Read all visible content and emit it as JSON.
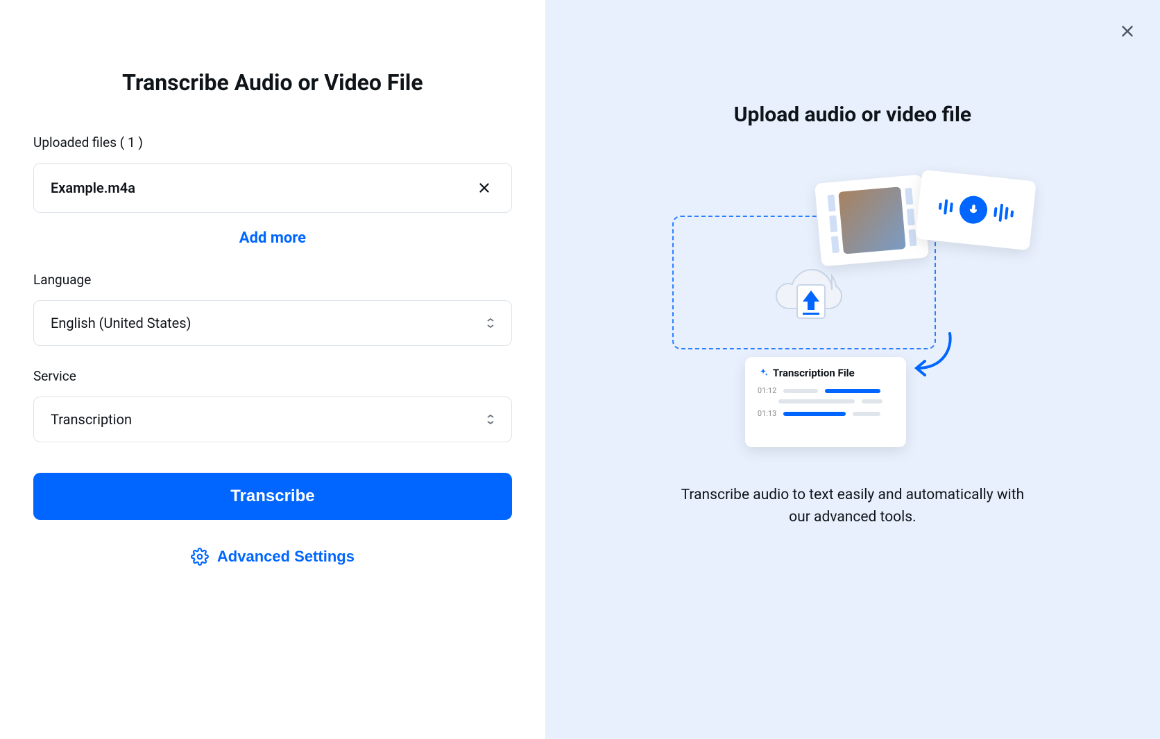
{
  "left": {
    "title": "Transcribe Audio or Video File",
    "uploaded_label": "Uploaded files ( 1 )",
    "file_name": "Example.m4a",
    "add_more": "Add more",
    "language_label": "Language",
    "language_value": "English (United States)",
    "service_label": "Service",
    "service_value": "Transcription",
    "transcribe_btn": "Transcribe",
    "advanced_settings": "Advanced Settings"
  },
  "right": {
    "title": "Upload audio or video file",
    "description": "Transcribe audio to text easily and automatically with our advanced tools.",
    "transcript_card_title": "Transcription File",
    "transcript_ts1": "01:12",
    "transcript_ts2": "01:13"
  },
  "colors": {
    "accent": "#0066ff",
    "panel_bg": "#e8f0fd"
  }
}
